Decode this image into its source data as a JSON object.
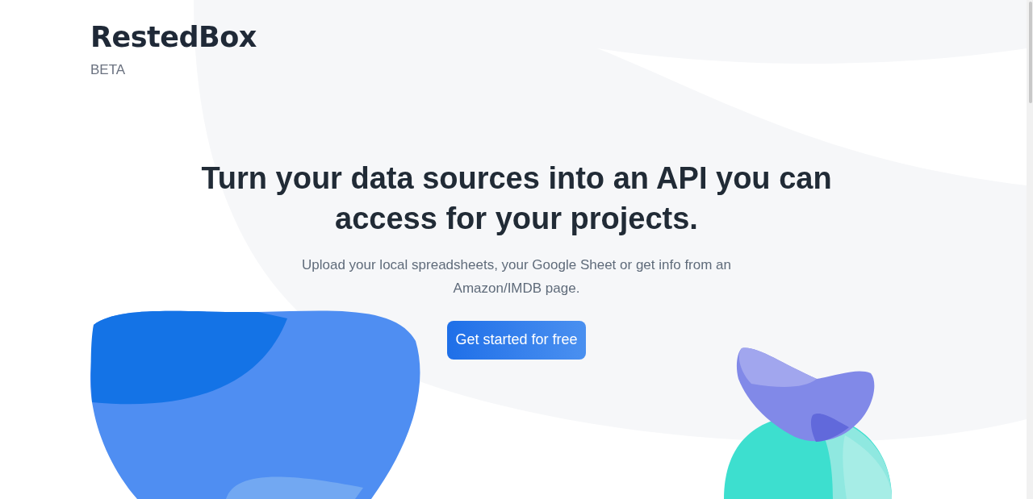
{
  "brand": {
    "name": "RestedBox",
    "tag": "BETA"
  },
  "hero": {
    "headline": "Turn your data sources into an API you can access for your projects.",
    "subtitle": "Upload your local spreadsheets, your Google Sheet or get info from an Amazon/IMDB page.",
    "cta": "Get started for free"
  }
}
